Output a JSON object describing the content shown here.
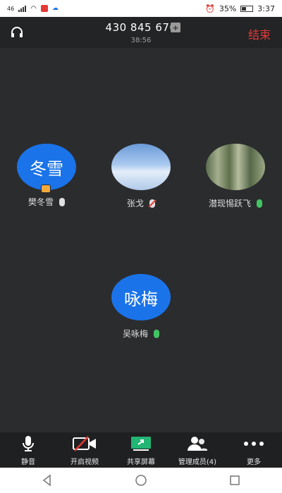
{
  "status_bar": {
    "left_text": "46",
    "battery": "35%",
    "time": "3:37"
  },
  "header": {
    "meeting_id": "430 845 676",
    "timer": "38:56",
    "end_label": "结束"
  },
  "participants": [
    {
      "avatar_text": "冬雪",
      "name": "樊冬雪",
      "mic": "active-white",
      "host": true
    },
    {
      "avatar_text": "",
      "name": "张戈",
      "mic": "muted",
      "host": false
    },
    {
      "avatar_text": "",
      "name": "潜现惕跃飞",
      "mic": "active-green",
      "host": false
    },
    {
      "avatar_text": "咏梅",
      "name": "吴咏梅",
      "mic": "active-green",
      "host": false
    }
  ],
  "toolbar": [
    {
      "label": "静音",
      "icon": "mic-icon"
    },
    {
      "label": "开启视频",
      "icon": "video-off-icon"
    },
    {
      "label": "共享屏幕",
      "icon": "share-screen-icon"
    },
    {
      "label": "管理成员(4)",
      "icon": "members-icon"
    },
    {
      "label": "更多",
      "icon": "more-icon"
    }
  ],
  "colors": {
    "background": "#2b2c2e",
    "accent_blue": "#1a73e8",
    "end_red": "#e53935",
    "mic_green": "#43c463",
    "share_green": "#22b573"
  }
}
